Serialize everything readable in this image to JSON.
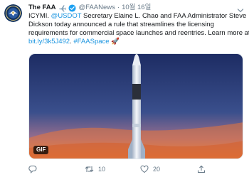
{
  "tweet": {
    "author_name": "The FAA",
    "handle": "@FAANews",
    "separator": "·",
    "date": "10월 16일",
    "text": {
      "line1_prefix": "ICYMI. ",
      "line1_mention": "@USDOT",
      "line1_suffix": " Secretary Elaine L. Chao and FAA Administrator Steve",
      "line2": "Dickson today announced a rule that streamlines the licensing",
      "line3": "requirements for commercial space launches and reentries. Learn more at",
      "link": "bit.ly/3k5J492",
      "hashtag": "#FAASpace",
      "emoji": "🚀"
    },
    "media": {
      "badge": "GIF"
    },
    "actions": {
      "replies": "",
      "retweets": "10",
      "likes": "20"
    }
  },
  "icons": {
    "avatar": "faa-seal-avatar",
    "plane": "airplane-emoji-icon",
    "verified": "verified-badge-icon",
    "more": "chevron-down-icon",
    "reply": "reply-icon",
    "retweet": "retweet-icon",
    "like": "heart-icon",
    "share": "share-icon"
  },
  "colors": {
    "link": "#1b95e0",
    "secondary_text": "#657786",
    "verified": "#1da1f2",
    "media_bg_top": "#20336b",
    "media_bg_bottom": "#f08a3c"
  }
}
